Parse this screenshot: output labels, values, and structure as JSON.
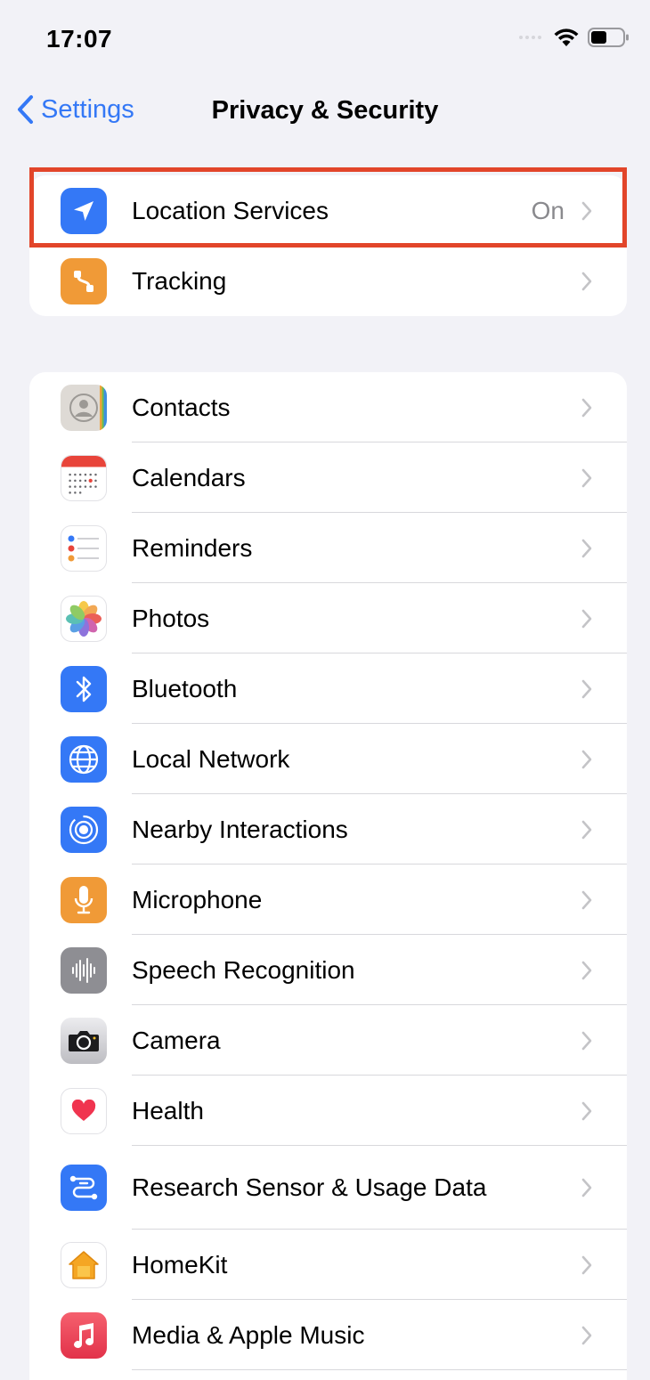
{
  "status_bar": {
    "time": "17:07",
    "wifi_icon": "wifi-icon",
    "battery_icon": "battery-icon",
    "battery_level": 0.5
  },
  "nav": {
    "back_label": "Settings",
    "title": "Privacy & Security"
  },
  "colors": {
    "accent": "#3478f6",
    "highlight": "#e2452a",
    "background": "#f2f2f7"
  },
  "group1": [
    {
      "label": "Location Services",
      "value": "On",
      "icon": "location-arrow-icon",
      "icon_color": "#3478f6"
    },
    {
      "label": "Tracking",
      "value": "",
      "icon": "tracking-icon",
      "icon_color": "#f09a37"
    }
  ],
  "group2": [
    {
      "label": "Contacts",
      "icon": "contacts-icon",
      "icon_color": "#d9d6d1"
    },
    {
      "label": "Calendars",
      "icon": "calendar-icon",
      "icon_color": "#ffffff"
    },
    {
      "label": "Reminders",
      "icon": "reminders-icon",
      "icon_color": "#ffffff"
    },
    {
      "label": "Photos",
      "icon": "photos-icon",
      "icon_color": "#ffffff"
    },
    {
      "label": "Bluetooth",
      "icon": "bluetooth-icon",
      "icon_color": "#3478f6"
    },
    {
      "label": "Local Network",
      "icon": "globe-icon",
      "icon_color": "#3478f6"
    },
    {
      "label": "Nearby Interactions",
      "icon": "nearby-icon",
      "icon_color": "#3478f6"
    },
    {
      "label": "Microphone",
      "icon": "microphone-icon",
      "icon_color": "#f09a37"
    },
    {
      "label": "Speech Recognition",
      "icon": "waveform-icon",
      "icon_color": "#8e8e93"
    },
    {
      "label": "Camera",
      "icon": "camera-icon",
      "icon_color": "#d0d0d4"
    },
    {
      "label": "Health",
      "icon": "heart-icon",
      "icon_color": "#ffffff"
    },
    {
      "label": "Research Sensor & Usage Data",
      "icon": "research-icon",
      "icon_color": "#3478f6"
    },
    {
      "label": "HomeKit",
      "icon": "home-icon",
      "icon_color": "#ffffff"
    },
    {
      "label": "Media & Apple Music",
      "icon": "music-note-icon",
      "icon_color": "#e9435a"
    }
  ]
}
